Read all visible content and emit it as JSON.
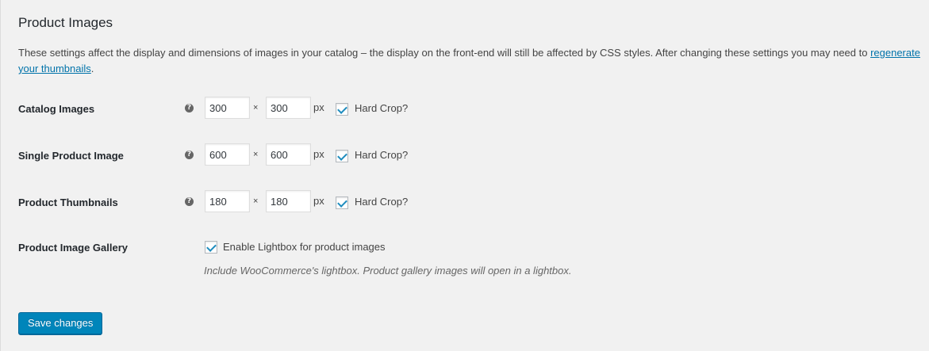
{
  "section": {
    "title": "Product Images",
    "description_text": "These settings affect the display and dimensions of images in your catalog – the display on the front-end will still be affected by CSS styles. After changing these settings you may need to ",
    "description_link": "regenerate your thumbnails",
    "description_end": "."
  },
  "rows": [
    {
      "label": "Catalog Images",
      "width": "300",
      "height": "300",
      "times": "×",
      "unit": "px",
      "crop_label": "Hard Crop?",
      "crop_checked": true,
      "help": "?"
    },
    {
      "label": "Single Product Image",
      "width": "600",
      "height": "600",
      "times": "×",
      "unit": "px",
      "crop_label": "Hard Crop?",
      "crop_checked": true,
      "help": "?"
    },
    {
      "label": "Product Thumbnails",
      "width": "180",
      "height": "180",
      "times": "×",
      "unit": "px",
      "crop_label": "Hard Crop?",
      "crop_checked": true,
      "help": "?"
    }
  ],
  "gallery": {
    "label": "Product Image Gallery",
    "checkbox_label": "Enable Lightbox for product images",
    "checked": true,
    "description": "Include WooCommerce's lightbox. Product gallery images will open in a lightbox."
  },
  "save_button": {
    "label": "Save changes"
  },
  "colors": {
    "background": "#f1f1f1",
    "link": "#0073aa",
    "primary_button": "#0085ba",
    "check": "#1e8cbe"
  }
}
